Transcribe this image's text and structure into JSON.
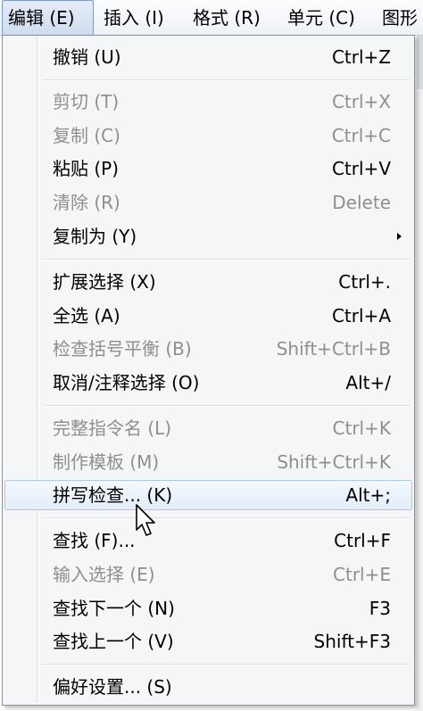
{
  "menubar": {
    "items": [
      {
        "label": "编辑 (E)",
        "active": true
      },
      {
        "label": "插入 (I)"
      },
      {
        "label": "格式 (R)"
      },
      {
        "label": "单元 (C)"
      },
      {
        "label": "图形"
      }
    ]
  },
  "edit_menu": {
    "items": [
      {
        "label": "撤销 (U)",
        "shortcut": "Ctrl+Z",
        "enabled": true
      },
      {
        "label": "剪切 (T)",
        "shortcut": "Ctrl+X",
        "enabled": false
      },
      {
        "label": "复制 (C)",
        "shortcut": "Ctrl+C",
        "enabled": false
      },
      {
        "label": "粘贴 (P)",
        "shortcut": "Ctrl+V",
        "enabled": true
      },
      {
        "label": "清除 (R)",
        "shortcut": "Delete",
        "enabled": false
      },
      {
        "label": "复制为 (Y)",
        "shortcut": "",
        "enabled": true,
        "submenu": true
      },
      {
        "label": "扩展选择 (X)",
        "shortcut": "Ctrl+.",
        "enabled": true
      },
      {
        "label": "全选 (A)",
        "shortcut": "Ctrl+A",
        "enabled": true
      },
      {
        "label": "检查括号平衡 (B)",
        "shortcut": "Shift+Ctrl+B",
        "enabled": false
      },
      {
        "label": "取消/注释选择 (O)",
        "shortcut": "Alt+/",
        "enabled": true
      },
      {
        "label": "完整指令名 (L)",
        "shortcut": "Ctrl+K",
        "enabled": false
      },
      {
        "label": "制作模板 (M)",
        "shortcut": "Shift+Ctrl+K",
        "enabled": false
      },
      {
        "label": "拼写检查... (K)",
        "shortcut": "Alt+;",
        "enabled": true,
        "highlighted": true
      },
      {
        "label": "查找 (F)...",
        "shortcut": "Ctrl+F",
        "enabled": true
      },
      {
        "label": "输入选择 (E)",
        "shortcut": "Ctrl+E",
        "enabled": false
      },
      {
        "label": "查找下一个 (N)",
        "shortcut": "F3",
        "enabled": true
      },
      {
        "label": "查找上一个 (V)",
        "shortcut": "Shift+F3",
        "enabled": true
      },
      {
        "label": "偏好设置... (S)",
        "shortcut": "",
        "enabled": true
      }
    ]
  },
  "colors": {
    "disabled_text": "#8f8f8f",
    "highlight_border": "#a8c8ea",
    "menu_background": "#f5f6f7"
  }
}
